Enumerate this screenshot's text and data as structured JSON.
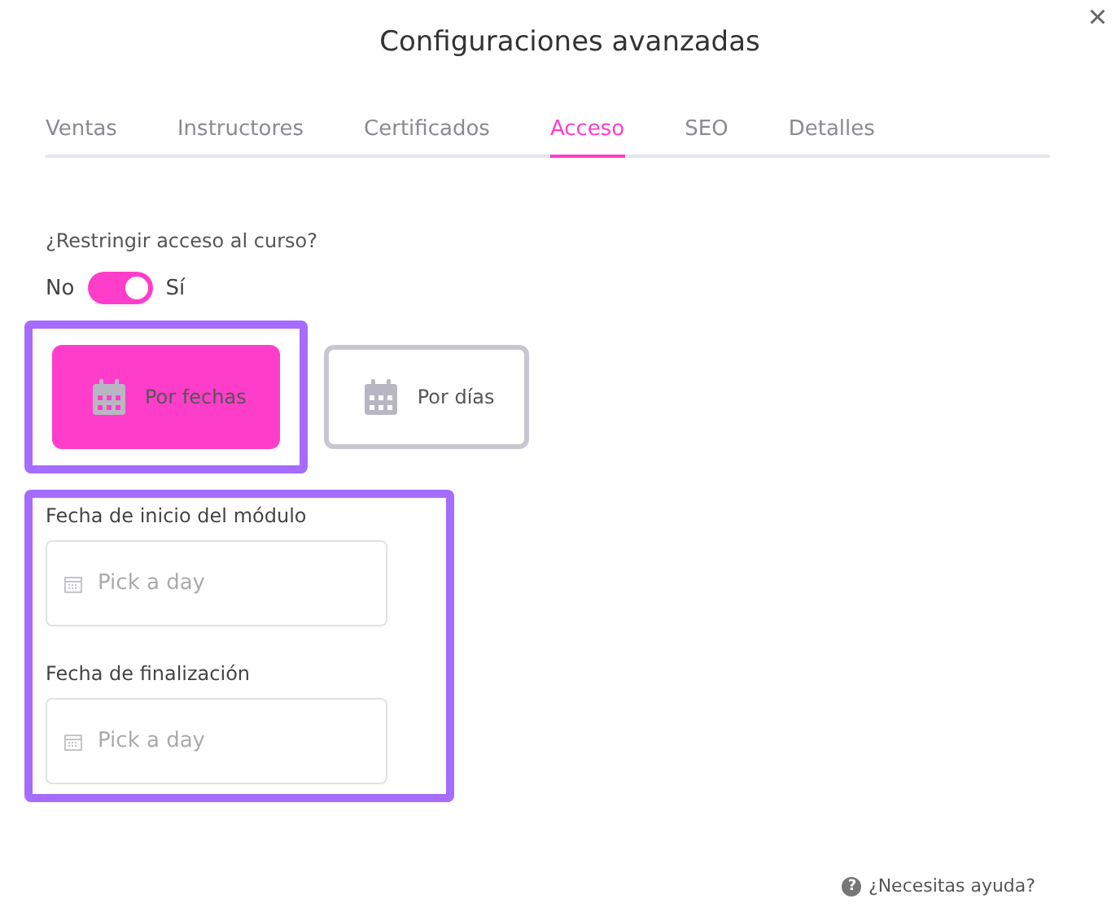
{
  "dialog": {
    "title": "Configuraciones avanzadas",
    "close": "×"
  },
  "tabs": [
    {
      "label": "Ventas",
      "selected": false
    },
    {
      "label": "Instructores",
      "selected": false
    },
    {
      "label": "Certificados",
      "selected": false
    },
    {
      "label": "Acceso",
      "selected": true
    },
    {
      "label": "SEO",
      "selected": false
    },
    {
      "label": "Detalles",
      "selected": false
    }
  ],
  "restrict": {
    "question": "¿Restringir acceso al curso?",
    "off_label": "No",
    "on_label": "Sí",
    "on": true
  },
  "modes": [
    {
      "label": "Por fechas",
      "selected": true,
      "highlighted": true
    },
    {
      "label": "Por días",
      "selected": false,
      "highlighted": false
    }
  ],
  "dates": {
    "highlighted": true,
    "fields": [
      {
        "label": "Fecha de inicio del módulo",
        "placeholder": "Pick a day"
      },
      {
        "label": "Fecha de finalización",
        "placeholder": "Pick a day"
      }
    ]
  },
  "help": {
    "icon": "?",
    "label": "¿Necesitas ayuda?"
  }
}
